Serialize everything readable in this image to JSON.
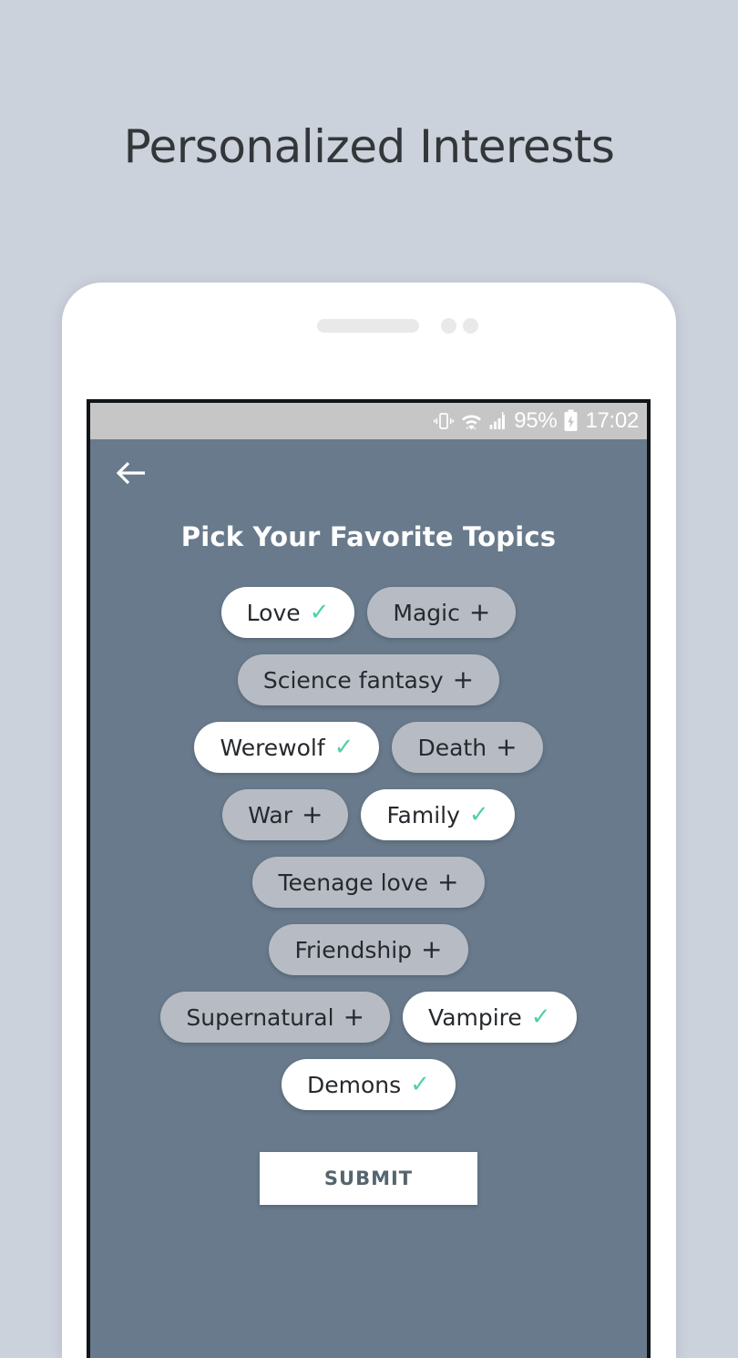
{
  "promo": {
    "title": "Personalized Interests"
  },
  "colors": {
    "page_background": "#ccd2dc",
    "app_background": "#687a8b",
    "status_bar": "#c6c6c6",
    "chip_unselected": "#b7bcc4",
    "chip_selected": "#ffffff",
    "check_green": "#4fd1a5",
    "submit_text": "#56656f",
    "phone_body": "#ffffff"
  },
  "status_bar": {
    "icons": [
      "vibrate-icon",
      "wifi-icon",
      "signal-icon",
      "battery-charging-icon"
    ],
    "battery_percent": "95%",
    "clock": "17:02"
  },
  "app_bar": {
    "back_icon": "back-arrow-icon"
  },
  "screen": {
    "title": "Pick Your Favorite Topics"
  },
  "chips": {
    "selected_mark": "✓",
    "unselected_mark": "+",
    "rows": [
      [
        {
          "label": "Love",
          "selected": true
        },
        {
          "label": "Magic",
          "selected": false
        }
      ],
      [
        {
          "label": "Science fantasy",
          "selected": false
        }
      ],
      [
        {
          "label": "Werewolf",
          "selected": true
        },
        {
          "label": "Death",
          "selected": false
        }
      ],
      [
        {
          "label": "War",
          "selected": false
        },
        {
          "label": "Family",
          "selected": true
        }
      ],
      [
        {
          "label": "Teenage love",
          "selected": false
        }
      ],
      [
        {
          "label": "Friendship",
          "selected": false
        }
      ],
      [
        {
          "label": "Supernatural",
          "selected": false
        },
        {
          "label": "Vampire",
          "selected": true
        }
      ],
      [
        {
          "label": "Demons",
          "selected": true
        }
      ]
    ]
  },
  "submit": {
    "label": "SUBMIT"
  }
}
